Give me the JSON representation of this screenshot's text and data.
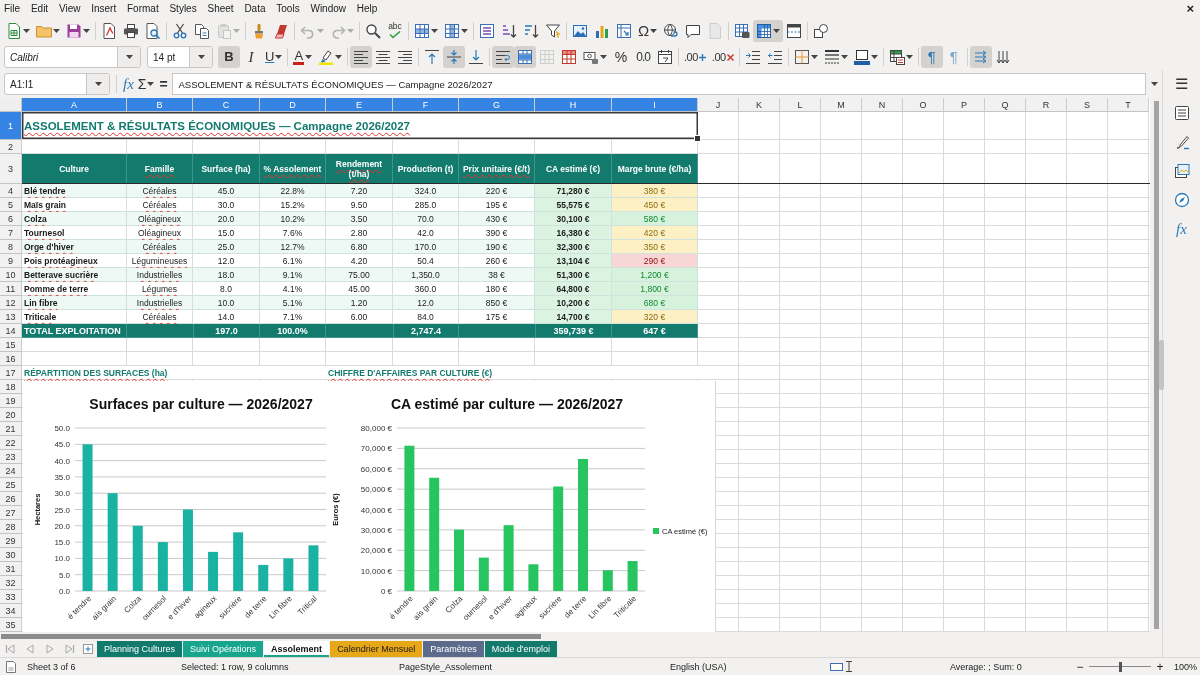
{
  "menu_bar": [
    "File",
    "Edit",
    "View",
    "Insert",
    "Format",
    "Styles",
    "Sheet",
    "Data",
    "Tools",
    "Window",
    "Help"
  ],
  "document_close": "×",
  "standard_toolbar": [
    {
      "pressed": false,
      "disabled": false
    },
    {
      "pressed": false,
      "disabled": false
    },
    {
      "pressed": false,
      "disabled": false
    },
    {
      "pressed": false,
      "disabled": false
    },
    {
      "pressed": false,
      "disabled": false
    },
    {
      "pressed": false,
      "disabled": false
    },
    {
      "pressed": false,
      "disabled": false
    },
    {
      "pressed": false,
      "disabled": false
    },
    {
      "pressed": false,
      "disabled": true
    },
    {
      "pressed": false,
      "disabled": false
    },
    {
      "pressed": false,
      "disabled": false
    },
    {
      "pressed": false,
      "disabled": true
    },
    {
      "pressed": false,
      "disabled": true
    },
    {
      "pressed": false,
      "disabled": false
    },
    {
      "glyph": "abc",
      "pressed": false,
      "disabled": false
    },
    {
      "pressed": false,
      "disabled": false
    },
    {
      "pressed": false,
      "disabled": false
    },
    {
      "pressed": false,
      "disabled": false
    },
    {
      "pressed": false,
      "disabled": false
    },
    {
      "pressed": false,
      "disabled": false
    },
    {
      "pressed": false,
      "disabled": false
    },
    {
      "pressed": false,
      "disabled": false
    },
    {
      "pressed": false,
      "disabled": false
    },
    {
      "pressed": false,
      "disabled": false
    },
    {
      "glyph": "Ω",
      "pressed": false,
      "disabled": false
    },
    {
      "pressed": false,
      "disabled": false
    },
    {
      "pressed": false,
      "disabled": false
    },
    {
      "pressed": false,
      "disabled": true
    },
    {
      "pressed": false,
      "disabled": false
    },
    {
      "pressed": true,
      "disabled": false
    },
    {
      "pressed": false,
      "disabled": false
    },
    {
      "pressed": false,
      "disabled": false
    }
  ],
  "formatting_toolbar": {
    "font_name": "Calibri",
    "font_size": "14 pt",
    "buttons": [
      {
        "glyph": "B",
        "pressed": true,
        "disabled": false
      },
      {
        "glyph": "I",
        "pressed": false,
        "disabled": false
      },
      {
        "glyph": "U",
        "pressed": false,
        "disabled": false
      },
      {
        "glyph": "A",
        "pressed": false,
        "disabled": false
      },
      {
        "pressed": false,
        "disabled": false
      },
      {
        "pressed": true,
        "disabled": false
      },
      {
        "pressed": false,
        "disabled": false
      },
      {
        "pressed": false,
        "disabled": false
      },
      {
        "pressed": false,
        "disabled": false
      },
      {
        "pressed": true,
        "disabled": false
      },
      {
        "pressed": false,
        "disabled": false
      },
      {
        "pressed": true,
        "disabled": false
      },
      {
        "pressed": true,
        "disabled": false
      },
      {
        "pressed": false,
        "disabled": true
      },
      {
        "pressed": false,
        "disabled": false
      },
      {
        "pressed": false,
        "disabled": false
      },
      {
        "glyph": "%",
        "pressed": false,
        "disabled": false
      },
      {
        "glyph": "0.0",
        "pressed": false,
        "disabled": false
      },
      {
        "pressed": false,
        "disabled": false
      },
      {
        "glyph": ".00",
        "pressed": false,
        "disabled": false
      },
      {
        "glyph": ".00",
        "pressed": false,
        "disabled": false
      },
      {
        "pressed": false,
        "disabled": false
      },
      {
        "pressed": false,
        "disabled": false
      },
      {
        "pressed": false,
        "disabled": false
      },
      {
        "pressed": false,
        "disabled": false
      },
      {
        "pressed": false,
        "disabled": false
      },
      {
        "pressed": false,
        "disabled": false
      },
      {
        "glyph": "¶",
        "pressed": true,
        "disabled": false
      },
      {
        "glyph": "¶",
        "pressed": false,
        "disabled": false
      },
      {
        "pressed": true,
        "disabled": false
      },
      {
        "pressed": false,
        "disabled": false
      }
    ]
  },
  "formula_bar": {
    "cell_reference": "A1:I1",
    "buttons": [
      "fx",
      "Σ",
      "="
    ],
    "content": "ASSOLEMENT & RÉSULTATS ÉCONOMIQUES — Campagne 2026/2027"
  },
  "sidebar": {
    "menu": "☰",
    "functions": "fx"
  },
  "sheet": {
    "column_headers": [
      {
        "label": "A",
        "selected": true
      },
      {
        "label": "B",
        "selected": true
      },
      {
        "label": "C",
        "selected": true
      },
      {
        "label": "D",
        "selected": true
      },
      {
        "label": "E",
        "selected": true
      },
      {
        "label": "F",
        "selected": true
      },
      {
        "label": "G",
        "selected": true
      },
      {
        "label": "H",
        "selected": true
      },
      {
        "label": "I",
        "selected": true
      },
      {
        "label": "J",
        "selected": false
      },
      {
        "label": "K",
        "selected": false
      },
      {
        "label": "L",
        "selected": false
      },
      {
        "label": "M",
        "selected": false
      },
      {
        "label": "N",
        "selected": false
      },
      {
        "label": "O",
        "selected": false
      },
      {
        "label": "P",
        "selected": false
      },
      {
        "label": "Q",
        "selected": false
      },
      {
        "label": "R",
        "selected": false
      },
      {
        "label": "S",
        "selected": false
      },
      {
        "label": "T",
        "selected": false
      }
    ],
    "row_headers": [
      {
        "label": "1",
        "selected": true
      },
      {
        "label": "2",
        "selected": false
      },
      {
        "label": "3",
        "selected": false
      },
      {
        "label": "4",
        "selected": false
      },
      {
        "label": "5",
        "selected": false
      },
      {
        "label": "6",
        "selected": false
      },
      {
        "label": "7",
        "selected": false
      },
      {
        "label": "8",
        "selected": false
      },
      {
        "label": "9",
        "selected": false
      },
      {
        "label": "10",
        "selected": false
      },
      {
        "label": "11",
        "selected": false
      },
      {
        "label": "12",
        "selected": false
      },
      {
        "label": "13",
        "selected": false
      },
      {
        "label": "14",
        "selected": false
      },
      {
        "label": "15",
        "selected": false
      },
      {
        "label": "16",
        "selected": false
      },
      {
        "label": "17",
        "selected": false
      },
      {
        "label": "18",
        "selected": false
      },
      {
        "label": "19",
        "selected": false
      },
      {
        "label": "20",
        "selected": false
      },
      {
        "label": "21",
        "selected": false
      },
      {
        "label": "22",
        "selected": false
      },
      {
        "label": "23",
        "selected": false
      },
      {
        "label": "24",
        "selected": false
      },
      {
        "label": "25",
        "selected": false
      },
      {
        "label": "26",
        "selected": false
      },
      {
        "label": "27",
        "selected": false
      },
      {
        "label": "28",
        "selected": false
      },
      {
        "label": "29",
        "selected": false
      },
      {
        "label": "30",
        "selected": false
      },
      {
        "label": "31",
        "selected": false
      },
      {
        "label": "32",
        "selected": false
      },
      {
        "label": "33",
        "selected": false
      },
      {
        "label": "34",
        "selected": false
      },
      {
        "label": "35",
        "selected": false
      }
    ],
    "freeze_line": true,
    "spellcheck_marks": true,
    "title": {
      "text": "ASSOLEMENT & RÉSULTATS ÉCONOMIQUES — Campagne 2026/2027",
      "selected": true
    },
    "table": {
      "columns": [
        "Culture",
        "Famille",
        "Surface (ha)",
        "% Assolement",
        "Rendement (t/ha)",
        "Production (t)",
        "Prix unitaire (€/t)",
        "CA estimé (€)",
        "Marge brute (€/ha)"
      ],
      "rows": [
        {
          "culture": "Blé tendre",
          "family": "Céréales",
          "surface": "45.0",
          "share": "22.8%",
          "yield": "7.20",
          "production": "324.0",
          "unit_price": "220 €",
          "revenue": "71,280 €",
          "gross_margin": {
            "value": "380 €",
            "color": "#fdf0c4"
          }
        },
        {
          "culture": "Maïs grain",
          "family": "Céréales",
          "surface": "30.0",
          "share": "15.2%",
          "yield": "9.50",
          "production": "285.0",
          "unit_price": "195 €",
          "revenue": "55,575 €",
          "gross_margin": {
            "value": "450 €",
            "color": "#fdf0c4"
          }
        },
        {
          "culture": "Colza",
          "family": "Oléagineux",
          "surface": "20.0",
          "share": "10.2%",
          "yield": "3.50",
          "production": "70.0",
          "unit_price": "430 €",
          "revenue": "30,100 €",
          "gross_margin": {
            "value": "580 €",
            "color": "#d6f2dd"
          }
        },
        {
          "culture": "Tournesol",
          "family": "Oléagineux",
          "surface": "15.0",
          "share": "7.6%",
          "yield": "2.80",
          "production": "42.0",
          "unit_price": "390 €",
          "revenue": "16,380 €",
          "gross_margin": {
            "value": "420 €",
            "color": "#fdf0c4"
          }
        },
        {
          "culture": "Orge d'hiver",
          "family": "Céréales",
          "surface": "25.0",
          "share": "12.7%",
          "yield": "6.80",
          "production": "170.0",
          "unit_price": "190 €",
          "revenue": "32,300 €",
          "gross_margin": {
            "value": "350 €",
            "color": "#fdf0c4"
          }
        },
        {
          "culture": "Pois protéagineux",
          "family": "Légumineuses",
          "surface": "12.0",
          "share": "6.1%",
          "yield": "4.20",
          "production": "50.4",
          "unit_price": "260 €",
          "revenue": "13,104 €",
          "gross_margin": {
            "value": "290 €",
            "color": "#f9d6d6"
          }
        },
        {
          "culture": "Betterave sucrière",
          "family": "Industrielles",
          "surface": "18.0",
          "share": "9.1%",
          "yield": "75.00",
          "production": "1,350.0",
          "unit_price": "38 €",
          "revenue": "51,300 €",
          "gross_margin": {
            "value": "1,200 €",
            "color": "#d6f2dd"
          }
        },
        {
          "culture": "Pomme de terre",
          "family": "Légumes",
          "surface": "8.0",
          "share": "4.1%",
          "yield": "45.00",
          "production": "360.0",
          "unit_price": "180 €",
          "revenue": "64,800 €",
          "gross_margin": {
            "value": "1,800 €",
            "color": "#d6f2dd"
          }
        },
        {
          "culture": "Lin fibre",
          "family": "Industrielles",
          "surface": "10.0",
          "share": "5.1%",
          "yield": "1.20",
          "production": "12.0",
          "unit_price": "850 €",
          "revenue": "10,200 €",
          "gross_margin": {
            "value": "680 €",
            "color": "#d6f2dd"
          }
        },
        {
          "culture": "Triticale",
          "family": "Céréales",
          "surface": "14.0",
          "share": "7.1%",
          "yield": "6.00",
          "production": "84.0",
          "unit_price": "175 €",
          "revenue": "14,700 €",
          "gross_margin": {
            "value": "320 €",
            "color": "#fdf0c4"
          }
        }
      ],
      "total": {
        "culture": "TOTAL EXPLOITATION",
        "surface": "197.0",
        "share": "100.0%",
        "production": "2,747.4",
        "revenue": "359,739 €",
        "gross_margin": "647 €"
      }
    },
    "section_labels": [
      "RÉPARTITION DES SURFACES (ha)",
      "CHIFFRE D'AFFAIRES PAR CULTURE (€)"
    ],
    "charts": [
      {
        "chart_data": {
          "type": "bar",
          "title": "Surfaces par culture — 2026/2027",
          "ylabel": "Hectares",
          "categories": [
            "é tendre",
            "aïs grain",
            "Colza",
            "ournesol",
            "e d'hiver",
            "agineux",
            "sucrière",
            "de terre",
            "Lin fibre",
            "Tritical"
          ],
          "series": [
            {
              "color": "#1ab3a3",
              "values": [
                45,
                30,
                20,
                15,
                25,
                12,
                18,
                8,
                10,
                14
              ]
            }
          ],
          "ylim": [
            0,
            50
          ],
          "yticks": [
            {
              "value": 0,
              "label": "0.0"
            },
            {
              "value": 5,
              "label": "5.0"
            },
            {
              "value": 10,
              "label": "10.0"
            },
            {
              "value": 15,
              "label": "15.0"
            },
            {
              "value": 20,
              "label": "20.0"
            },
            {
              "value": 25,
              "label": "25.0"
            },
            {
              "value": 30,
              "label": "30.0"
            },
            {
              "value": 35,
              "label": "35.0"
            },
            {
              "value": 40,
              "label": "40.0"
            },
            {
              "value": 45,
              "label": "45.0"
            },
            {
              "value": 50,
              "label": "50.0"
            }
          ],
          "grid": true
        }
      },
      {
        "chart_data": {
          "type": "bar",
          "title": "CA estimé par culture — 2026/2027",
          "ylabel": "Euros (€)",
          "categories": [
            "é tendre",
            "aïs grain",
            "Colza",
            "ournesol",
            "e d'hiver",
            "agineux",
            "sucrière",
            "de terre",
            "Lin fibre",
            "Triticale"
          ],
          "series": [
            {
              "name": "CA estimé (€)",
              "color": "#26c55f",
              "values": [
                71280,
                55575,
                30100,
                16380,
                32300,
                13104,
                51300,
                64800,
                10200,
                14700
              ]
            }
          ],
          "ylim": [
            0,
            80000
          ],
          "yticks": [
            {
              "value": 0,
              "label": "0 €"
            },
            {
              "value": 10000,
              "label": "10,000 €"
            },
            {
              "value": 20000,
              "label": "20,000 €"
            },
            {
              "value": 30000,
              "label": "30,000 €"
            },
            {
              "value": 40000,
              "label": "40,000 €"
            },
            {
              "value": 50000,
              "label": "50,000 €"
            },
            {
              "value": 60000,
              "label": "60,000 €"
            },
            {
              "value": 70000,
              "label": "70,000 €"
            },
            {
              "value": 80000,
              "label": "80,000 €"
            }
          ],
          "grid": true
        }
      }
    ]
  },
  "sheet_tabs": [
    {
      "label": "Planning Cultures",
      "color": "#127a6d",
      "selected": false
    },
    {
      "label": "Suivi Opérations",
      "color": "#17a58e",
      "selected": false
    },
    {
      "label": "Assolement",
      "color": "#1ba38a",
      "selected": true
    },
    {
      "label": "Calendrier Mensuel",
      "color": "#e6a817",
      "selected": false
    },
    {
      "label": "Paramètres",
      "color": "#5c6b8c",
      "selected": false
    },
    {
      "label": "Mode d'emploi",
      "color": "#137a6c",
      "selected": false
    }
  ],
  "status_bar": {
    "sheet": "Sheet 3 of 6",
    "selection": "Selected: 1 row, 9 columns",
    "page_style": "PageStyle_Assolement",
    "language": "English (USA)",
    "summary": "Average: ; Sum: 0",
    "zoom_out": "−",
    "zoom_in": "+",
    "zoom": {
      "level": 0.5
    },
    "zoom_value": "100%"
  }
}
